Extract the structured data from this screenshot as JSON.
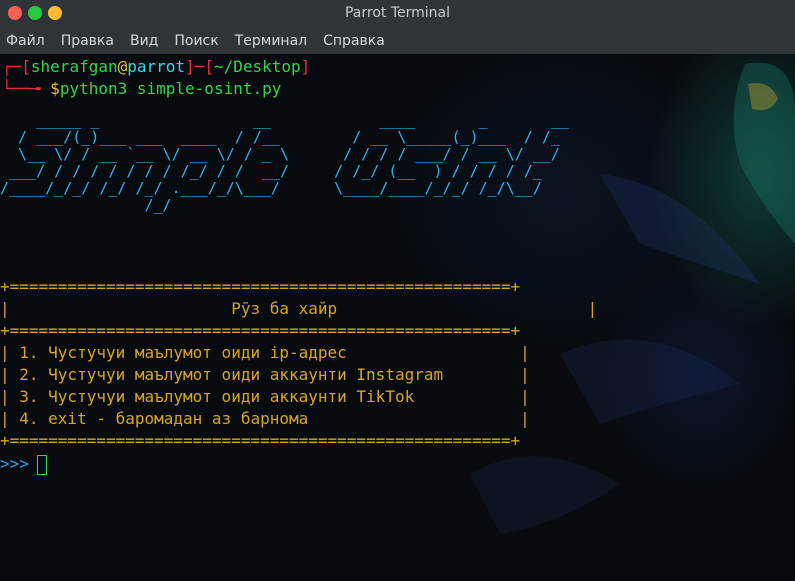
{
  "window": {
    "title": "Parrot Terminal"
  },
  "menu": [
    "Файл",
    "Правка",
    "Вид",
    "Поиск",
    "Терминал",
    "Справка"
  ],
  "prompt": {
    "user": "sherafgan",
    "host": "parrot",
    "path": "~/Desktop",
    "command": "python3 simple-osint.py"
  },
  "ascii_banner": [
    "    _____ _                 __            ____       _       __",
    "  / ___/(_)___ ___  ____  / /__        / __ \\_____(_)___  / /_",
    "  \\__ \\/ / __ `__ \\/ __ \\/ / _ \\      / / / / ___/ / __ \\/ __/",
    " ___/ / / / / / / / /_/ / /  __/     / /_/ (__  ) / / / / /_",
    "/____/_/_/ /_/ /_/ .___/_/\\___/      \\____/____/_/_/ /_/\\__/",
    "                /_/"
  ],
  "box": {
    "border": "+====================================================+",
    "title": "Рӯз ба хайр",
    "items": [
      "1. Чустучуи маълумот оиди ip-адрес",
      "2. Чустучуи маълумот оиди аккаунти Instagram",
      "3. Чустучуи маълумот оиди аккаунти TikTok",
      "4. exit - баромадан аз барнома"
    ]
  },
  "input_prompt": ">>>",
  "colors": {
    "prompt_red": "#e0323a",
    "user_green": "#33d64a",
    "banner_blue": "#2fb3f0",
    "menu_orange": "#d9a521",
    "input_blue": "#3b9fe8"
  }
}
